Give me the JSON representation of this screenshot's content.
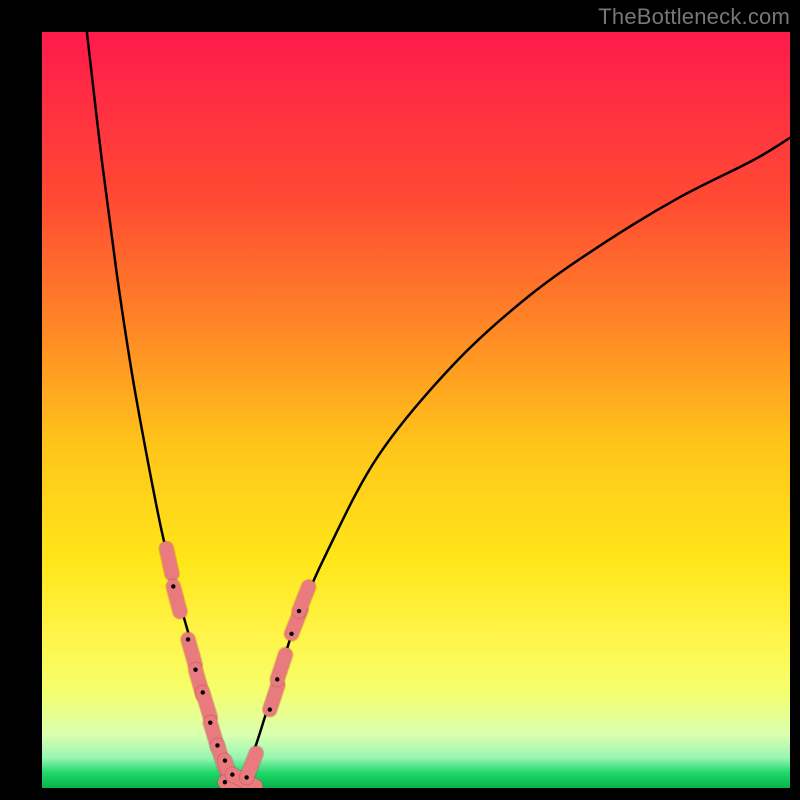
{
  "watermark": "TheBottleneck.com",
  "colors": {
    "frame": "#000000",
    "curve": "#000000",
    "marker_fill": "#e97a7e",
    "marker_stroke": "#9b2e2e",
    "gradient_stops": [
      {
        "pos": 0.0,
        "hex": "#ff1a4d"
      },
      {
        "pos": 0.22,
        "hex": "#ff4a33"
      },
      {
        "pos": 0.4,
        "hex": "#ff8a25"
      },
      {
        "pos": 0.55,
        "hex": "#ffc61a"
      },
      {
        "pos": 0.7,
        "hex": "#ffe61a"
      },
      {
        "pos": 0.8,
        "hex": "#fff44a"
      },
      {
        "pos": 0.87,
        "hex": "#f6ff6a"
      },
      {
        "pos": 0.93,
        "hex": "#daffb0"
      },
      {
        "pos": 0.96,
        "hex": "#98f5b2"
      },
      {
        "pos": 0.98,
        "hex": "#20d86a"
      },
      {
        "pos": 1.0,
        "hex": "#06b24a"
      }
    ]
  },
  "chart_data": {
    "type": "line",
    "title": "",
    "xlabel": "",
    "ylabel": "",
    "xlim": [
      0,
      100
    ],
    "ylim": [
      0,
      100
    ],
    "grid": false,
    "legend": false,
    "series": [
      {
        "name": "bottleneck-curve",
        "note": "V-shaped curve; minimum at x≈26, y≈0; y rises steeply toward x→0 and gradually toward x→100",
        "x": [
          6,
          8,
          10,
          12,
          14,
          16,
          18,
          20,
          22,
          24,
          26,
          28,
          30,
          32,
          34,
          38,
          45,
          55,
          65,
          75,
          85,
          95,
          100
        ],
        "y": [
          100,
          83,
          68,
          55,
          44,
          34,
          26,
          19,
          12,
          6,
          0,
          4,
          10,
          16,
          22,
          31,
          44,
          56,
          65,
          72,
          78,
          83,
          86
        ]
      }
    ],
    "markers": {
      "name": "highlighted-points",
      "shape": "rounded-capsule",
      "note": "Pink capsule markers clustered near the curve minimum on both arms",
      "points": [
        {
          "x": 17,
          "y": 30
        },
        {
          "x": 18,
          "y": 25
        },
        {
          "x": 20,
          "y": 18
        },
        {
          "x": 21,
          "y": 14
        },
        {
          "x": 22,
          "y": 11
        },
        {
          "x": 23,
          "y": 7
        },
        {
          "x": 24,
          "y": 4
        },
        {
          "x": 25,
          "y": 2
        },
        {
          "x": 26,
          "y": 0
        },
        {
          "x": 27,
          "y": 1
        },
        {
          "x": 28,
          "y": 3
        },
        {
          "x": 31,
          "y": 12
        },
        {
          "x": 32,
          "y": 16
        },
        {
          "x": 34,
          "y": 22
        },
        {
          "x": 35,
          "y": 25
        }
      ]
    }
  }
}
